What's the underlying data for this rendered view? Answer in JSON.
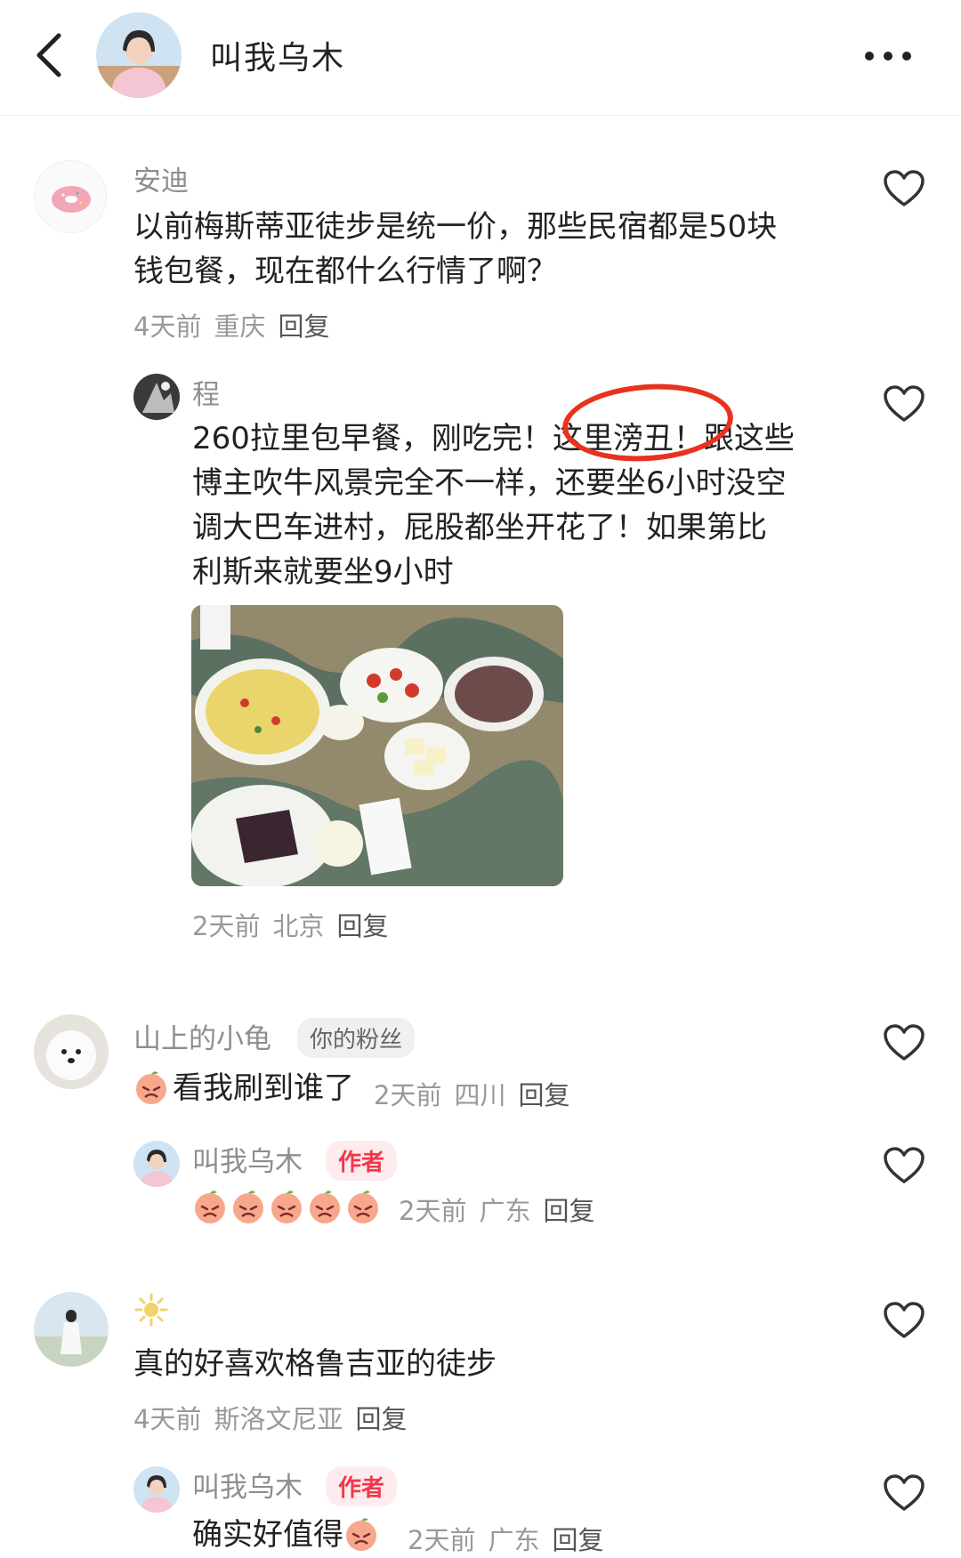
{
  "header": {
    "title": "叫我乌木"
  },
  "comments": [
    {
      "user": "安迪",
      "text_lines": [
        "以前梅斯蒂亚徒步是统一价，那些民宿都是50块",
        "钱包餐，现在都什么行情了啊？"
      ],
      "time": "4天前",
      "location": "重庆",
      "reply": "回复"
    },
    {
      "user": "程",
      "text_lines": [
        "260拉里包早餐，刚吃完！这里滂丑！跟这些",
        "博主吹牛风景完全不一样，还要坐6小时没空",
        "调大巴车进村，屁股都坐开花了！如果第比",
        "利斯来就要坐9小时"
      ],
      "time": "2天前",
      "location": "北京",
      "reply": "回复"
    },
    {
      "user": "山上的小龟",
      "badge": "你的粉丝",
      "text": "看我刷到谁了",
      "time": "2天前",
      "location": "四川",
      "reply": "回复"
    },
    {
      "user": "叫我乌木",
      "badge": "作者",
      "time": "2天前",
      "location": "广东",
      "reply": "回复"
    },
    {
      "user": "",
      "text": "真的好喜欢格鲁吉亚的徒步",
      "time": "4天前",
      "location": "斯洛文尼亚",
      "reply": "回复"
    },
    {
      "user": "叫我乌木",
      "badge": "作者",
      "text": "确实好值得",
      "time": "2天前",
      "location": "广东",
      "reply": "回复"
    }
  ],
  "icons": {
    "back": "chevron-left-icon",
    "more": "more-dots-icon",
    "like": "heart-outline-icon",
    "emoji": "peach-cry-emoji"
  },
  "colors": {
    "accent_red": "#e8321f",
    "author_badge": "#f2364b"
  }
}
